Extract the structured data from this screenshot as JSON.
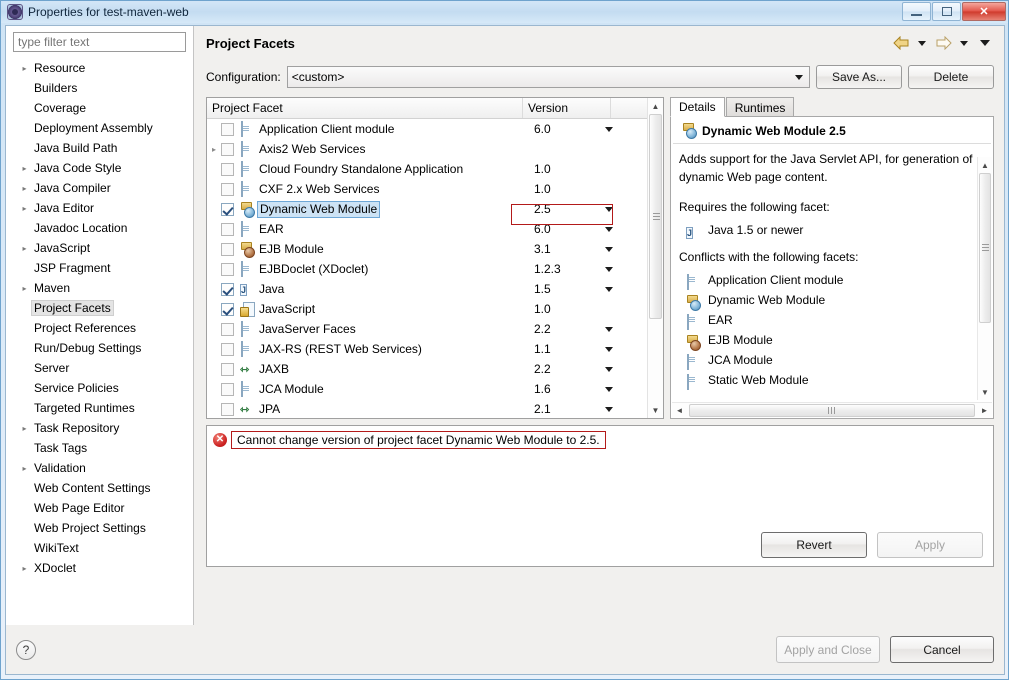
{
  "window": {
    "title": "Properties for test-maven-web",
    "icon": "eclipse-properties-icon",
    "minimize_label": "Minimize",
    "restore_label": "Restore",
    "close_label": "✕"
  },
  "sidebar": {
    "filter_placeholder": "type filter text",
    "filter_value": "",
    "items": [
      {
        "label": "Resource",
        "expandable": true,
        "selected": false
      },
      {
        "label": "Builders",
        "expandable": false,
        "selected": false
      },
      {
        "label": "Coverage",
        "expandable": false,
        "selected": false
      },
      {
        "label": "Deployment Assembly",
        "expandable": false,
        "selected": false
      },
      {
        "label": "Java Build Path",
        "expandable": false,
        "selected": false
      },
      {
        "label": "Java Code Style",
        "expandable": true,
        "selected": false
      },
      {
        "label": "Java Compiler",
        "expandable": true,
        "selected": false
      },
      {
        "label": "Java Editor",
        "expandable": true,
        "selected": false
      },
      {
        "label": "Javadoc Location",
        "expandable": false,
        "selected": false
      },
      {
        "label": "JavaScript",
        "expandable": true,
        "selected": false
      },
      {
        "label": "JSP Fragment",
        "expandable": false,
        "selected": false
      },
      {
        "label": "Maven",
        "expandable": true,
        "selected": false
      },
      {
        "label": "Project Facets",
        "expandable": false,
        "selected": true
      },
      {
        "label": "Project References",
        "expandable": false,
        "selected": false
      },
      {
        "label": "Run/Debug Settings",
        "expandable": false,
        "selected": false
      },
      {
        "label": "Server",
        "expandable": false,
        "selected": false
      },
      {
        "label": "Service Policies",
        "expandable": false,
        "selected": false
      },
      {
        "label": "Targeted Runtimes",
        "expandable": false,
        "selected": false
      },
      {
        "label": "Task Repository",
        "expandable": true,
        "selected": false
      },
      {
        "label": "Task Tags",
        "expandable": false,
        "selected": false
      },
      {
        "label": "Validation",
        "expandable": true,
        "selected": false
      },
      {
        "label": "Web Content Settings",
        "expandable": false,
        "selected": false
      },
      {
        "label": "Web Page Editor",
        "expandable": false,
        "selected": false
      },
      {
        "label": "Web Project Settings",
        "expandable": false,
        "selected": false
      },
      {
        "label": "WikiText",
        "expandable": false,
        "selected": false
      },
      {
        "label": "XDoclet",
        "expandable": true,
        "selected": false
      }
    ]
  },
  "page": {
    "title": "Project Facets",
    "nav": {
      "back_icon": "arrow-left-icon",
      "back_menu_icon": "chevron-down-icon",
      "forward_icon": "arrow-right-icon",
      "forward_menu_icon": "chevron-down-icon",
      "view_menu_icon": "chevron-down-icon"
    }
  },
  "configuration": {
    "label": "Configuration:",
    "value": "<custom>",
    "save_as_label": "Save As...",
    "delete_label": "Delete"
  },
  "facet_table": {
    "columns": [
      "Project Facet",
      "Version"
    ],
    "rows": [
      {
        "name": "Application Client module",
        "version": "6.0",
        "checked": false,
        "has_dropdown": true,
        "expandable": false,
        "icon": "doc-icon",
        "selected": false
      },
      {
        "name": "Axis2 Web Services",
        "version": "",
        "checked": false,
        "has_dropdown": false,
        "expandable": true,
        "icon": "doc-icon",
        "selected": false
      },
      {
        "name": "Cloud Foundry Standalone Application",
        "version": "1.0",
        "checked": false,
        "has_dropdown": false,
        "expandable": false,
        "icon": "doc-icon",
        "selected": false
      },
      {
        "name": "CXF 2.x Web Services",
        "version": "1.0",
        "checked": false,
        "has_dropdown": false,
        "expandable": false,
        "icon": "doc-icon",
        "selected": false
      },
      {
        "name": "Dynamic Web Module",
        "version": "2.5",
        "checked": true,
        "has_dropdown": true,
        "expandable": false,
        "icon": "web-icon",
        "selected": true
      },
      {
        "name": "EAR",
        "version": "6.0",
        "checked": false,
        "has_dropdown": true,
        "expandable": false,
        "icon": "doc-icon",
        "selected": false
      },
      {
        "name": "EJB Module",
        "version": "3.1",
        "checked": false,
        "has_dropdown": true,
        "expandable": false,
        "icon": "ejb-icon",
        "selected": false
      },
      {
        "name": "EJBDoclet (XDoclet)",
        "version": "1.2.3",
        "checked": false,
        "has_dropdown": true,
        "expandable": false,
        "icon": "doc-icon",
        "selected": false
      },
      {
        "name": "Java",
        "version": "1.5",
        "checked": true,
        "has_dropdown": true,
        "expandable": false,
        "icon": "java-icon",
        "selected": false
      },
      {
        "name": "JavaScript",
        "version": "1.0",
        "checked": true,
        "has_dropdown": false,
        "expandable": false,
        "icon": "javascript-icon",
        "selected": false
      },
      {
        "name": "JavaServer Faces",
        "version": "2.2",
        "checked": false,
        "has_dropdown": true,
        "expandable": false,
        "icon": "doc-icon",
        "selected": false
      },
      {
        "name": "JAX-RS (REST Web Services)",
        "version": "1.1",
        "checked": false,
        "has_dropdown": true,
        "expandable": false,
        "icon": "doc-icon",
        "selected": false
      },
      {
        "name": "JAXB",
        "version": "2.2",
        "checked": false,
        "has_dropdown": true,
        "expandable": false,
        "icon": "arrows-icon",
        "selected": false
      },
      {
        "name": "JCA Module",
        "version": "1.6",
        "checked": false,
        "has_dropdown": true,
        "expandable": false,
        "icon": "doc-icon",
        "selected": false
      },
      {
        "name": "JPA",
        "version": "2.1",
        "checked": false,
        "has_dropdown": true,
        "expandable": false,
        "icon": "arrows-icon",
        "selected": false
      }
    ]
  },
  "details": {
    "tabs": [
      {
        "label": "Details",
        "active": true
      },
      {
        "label": "Runtimes",
        "active": false
      }
    ],
    "heading": "Dynamic Web Module 2.5",
    "heading_icon": "web-icon",
    "description": "Adds support for the Java Servlet API, for generation of dynamic Web page content.",
    "requires_label": "Requires the following facet:",
    "requires": [
      {
        "label": "Java 1.5 or newer",
        "icon": "java-icon"
      }
    ],
    "conflicts_label": "Conflicts with the following facets:",
    "conflicts": [
      {
        "label": "Application Client module",
        "icon": "doc-icon"
      },
      {
        "label": "Dynamic Web Module",
        "icon": "web-icon"
      },
      {
        "label": "EAR",
        "icon": "doc-icon"
      },
      {
        "label": "EJB Module",
        "icon": "ejb-icon"
      },
      {
        "label": "JCA Module",
        "icon": "doc-icon"
      },
      {
        "label": "Static Web Module",
        "icon": "doc-icon"
      }
    ]
  },
  "message": {
    "icon": "error-icon",
    "icon_glyph": "✕",
    "text": "Cannot change version of project facet Dynamic Web Module to 2.5."
  },
  "actions": {
    "revert_label": "Revert",
    "apply_label": "Apply",
    "apply_enabled": false,
    "apply_and_close_label": "Apply and Close",
    "apply_and_close_enabled": false,
    "cancel_label": "Cancel",
    "help_label": "?"
  },
  "colors": {
    "error_red": "#b31a1a",
    "selection_blue": "#cde3f5",
    "title_gradient": "#cfe4f5"
  }
}
